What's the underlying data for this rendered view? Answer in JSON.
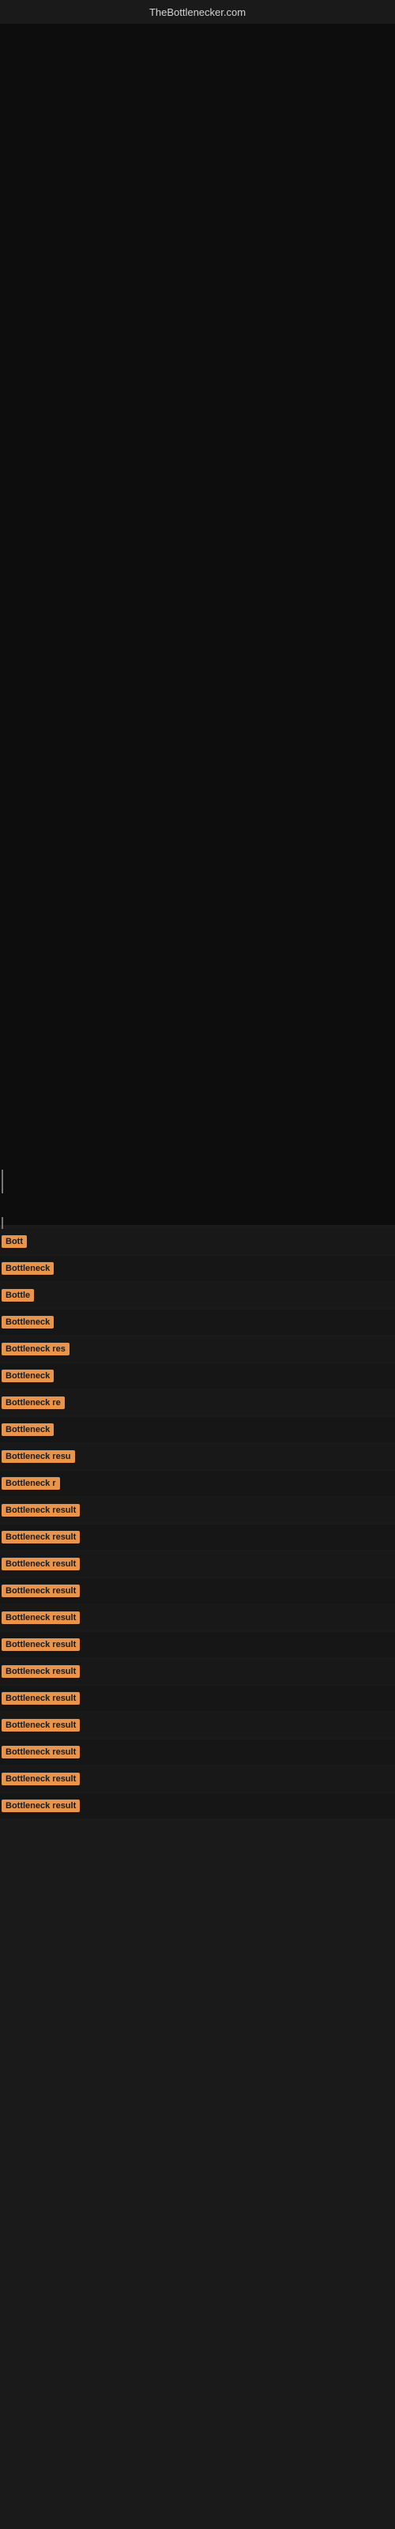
{
  "site": {
    "title": "TheBottlenecker.com"
  },
  "rows": [
    {
      "id": 1,
      "label": "Bottleneck result",
      "clip": "Bott"
    },
    {
      "id": 2,
      "label": "Bottleneck result",
      "clip": "Bottleneck"
    },
    {
      "id": 3,
      "label": "Bottleneck result",
      "clip": "Bottle"
    },
    {
      "id": 4,
      "label": "Bottleneck result",
      "clip": "Bottleneck"
    },
    {
      "id": 5,
      "label": "Bottleneck result",
      "clip": "Bottleneck res"
    },
    {
      "id": 6,
      "label": "Bottleneck result",
      "clip": "Bottleneck"
    },
    {
      "id": 7,
      "label": "Bottleneck result",
      "clip": "Bottleneck re"
    },
    {
      "id": 8,
      "label": "Bottleneck result",
      "clip": "Bottleneck"
    },
    {
      "id": 9,
      "label": "Bottleneck result",
      "clip": "Bottleneck resu"
    },
    {
      "id": 10,
      "label": "Bottleneck result",
      "clip": "Bottleneck r"
    },
    {
      "id": 11,
      "label": "Bottleneck result",
      "clip": "Bottleneck result"
    },
    {
      "id": 12,
      "label": "Bottleneck result",
      "clip": "Bottleneck result"
    },
    {
      "id": 13,
      "label": "Bottleneck result",
      "clip": "Bottleneck result"
    },
    {
      "id": 14,
      "label": "Bottleneck result",
      "clip": "Bottleneck result"
    },
    {
      "id": 15,
      "label": "Bottleneck result",
      "clip": "Bottleneck result"
    },
    {
      "id": 16,
      "label": "Bottleneck result",
      "clip": "Bottleneck result"
    },
    {
      "id": 17,
      "label": "Bottleneck result",
      "clip": "Bottleneck result"
    },
    {
      "id": 18,
      "label": "Bottleneck result",
      "clip": "Bottleneck result"
    },
    {
      "id": 19,
      "label": "Bottleneck result",
      "clip": "Bottleneck result"
    },
    {
      "id": 20,
      "label": "Bottleneck result",
      "clip": "Bottleneck result"
    },
    {
      "id": 21,
      "label": "Bottleneck result",
      "clip": "Bottleneck result"
    },
    {
      "id": 22,
      "label": "Bottleneck result",
      "clip": "Bottleneck result"
    }
  ],
  "colors": {
    "background": "#111111",
    "label_bg": "#e8944a",
    "label_text": "#111111",
    "site_title": "#cccccc"
  }
}
